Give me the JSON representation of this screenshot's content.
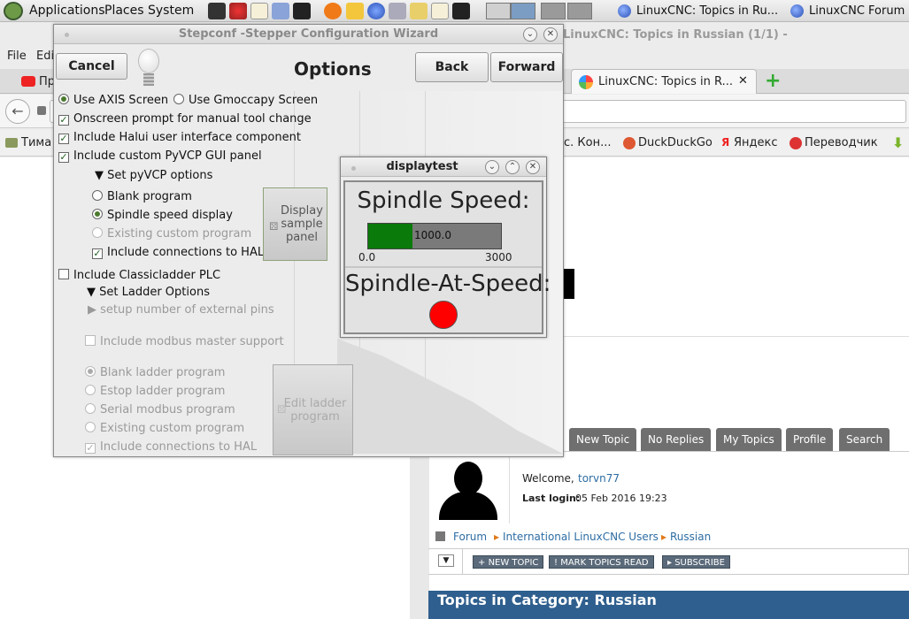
{
  "panel": {
    "menus": [
      "Applications",
      "Places",
      "System"
    ],
    "tasks": [
      "LinuxCNC: Topics in Ru...",
      "LinuxCNC Forum"
    ]
  },
  "firefox": {
    "title": "LinuxCNC: Topics in Russian (1/1) -",
    "menu": [
      "File",
      "Edi"
    ],
    "tabs": {
      "left": "Пр",
      "active": "LinuxCNC: Topics in R...",
      "close": "✕",
      "new": "+"
    },
    "bookmarks": {
      "left": "Тима",
      "items": [
        "с. Кон...",
        "DuckDuckGo",
        "Яндекс",
        "Переводчик"
      ]
    },
    "forum_nav": [
      "New Topic",
      "No Replies",
      "My Topics",
      "Profile",
      "Search"
    ],
    "profile": {
      "welcome": "Welcome,",
      "user": "torvn77",
      "last_login_label": "Last login:",
      "last_login": "05 Feb 2016 19:23"
    },
    "breadcrumb": [
      "Forum",
      "International LinuxCNC Users",
      "Russian"
    ],
    "actions": [
      "NEW TOPIC",
      "MARK TOPICS READ",
      "SUBSCRIBE"
    ],
    "category": "Topics in Category: Russian"
  },
  "stepconf": {
    "title": "Stepconf -Stepper Configuration Wizard",
    "heading": "Options",
    "cancel": "Cancel",
    "back": "Back",
    "forward": "Forward",
    "screen_options": [
      {
        "label": "Use AXIS Screen",
        "checked": true
      },
      {
        "label": "Use Gmoccapy Screen",
        "checked": false
      }
    ],
    "checks": [
      {
        "label": "Onscreen prompt for manual tool change",
        "checked": true
      },
      {
        "label": "Include Halui user interface component",
        "checked": true
      },
      {
        "label": "Include custom PyVCP GUI panel",
        "checked": true
      }
    ],
    "pyvcp_expander": "Set pyVCP options",
    "pyvcp_options": [
      "Blank program",
      "Spindle speed display",
      "Existing custom program"
    ],
    "pyvcp_hal": "Include connections to HAL",
    "display_btn": "Display sample panel",
    "classicladder": "Include Classicladder PLC",
    "ladder_expander": "Set Ladder Options",
    "ext_pins": "setup number of external pins",
    "modbus": "Include modbus master support",
    "ladder_options": [
      "Blank ladder program",
      "Estop ladder program",
      "Serial modbus program",
      "Existing custom program"
    ],
    "ladder_hal": "Include connections to HAL",
    "edit_btn": "Edit ladder program"
  },
  "displaytest": {
    "title": "displaytest",
    "speed_label": "Spindle Speed:",
    "speed_value": "1000.0",
    "speed_fraction": 0.333,
    "min": "0.0",
    "max": "3000",
    "at_speed_label": "Spindle-At-Speed:",
    "led_color": "#ff0000"
  }
}
